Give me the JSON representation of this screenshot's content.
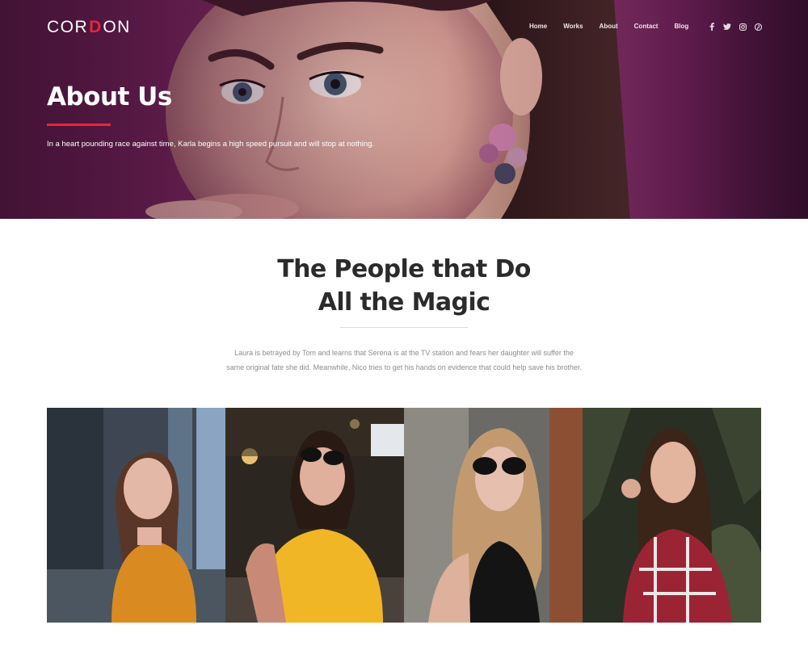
{
  "brand": {
    "logo_text_left": "COR",
    "logo_text_mid": "D",
    "logo_text_right": "ON",
    "accent_color": "#e8243f"
  },
  "nav": {
    "items": [
      {
        "label": "Home"
      },
      {
        "label": "Works"
      },
      {
        "label": "About"
      },
      {
        "label": "Contact"
      },
      {
        "label": "Blog"
      }
    ]
  },
  "social": {
    "icons": [
      "facebook-icon",
      "twitter-icon",
      "instagram-icon",
      "pinterest-icon"
    ]
  },
  "hero": {
    "title": "About Us",
    "subtitle": "In a heart pounding race against time, Karla begins a high speed pursuit and will stop at nothing."
  },
  "team_section": {
    "title_line1": "The People that Do",
    "title_line2": "All the Magic",
    "description": "Laura is betrayed by Tom and learns that Serena is at the TV station and fears her daughter will suffer the same original fate she did. Meanwhile, Nico tries to get his hands on evidence that could help save his brother.",
    "photos": [
      "team-photo-1",
      "team-photo-2",
      "team-photo-3",
      "team-photo-4"
    ]
  }
}
